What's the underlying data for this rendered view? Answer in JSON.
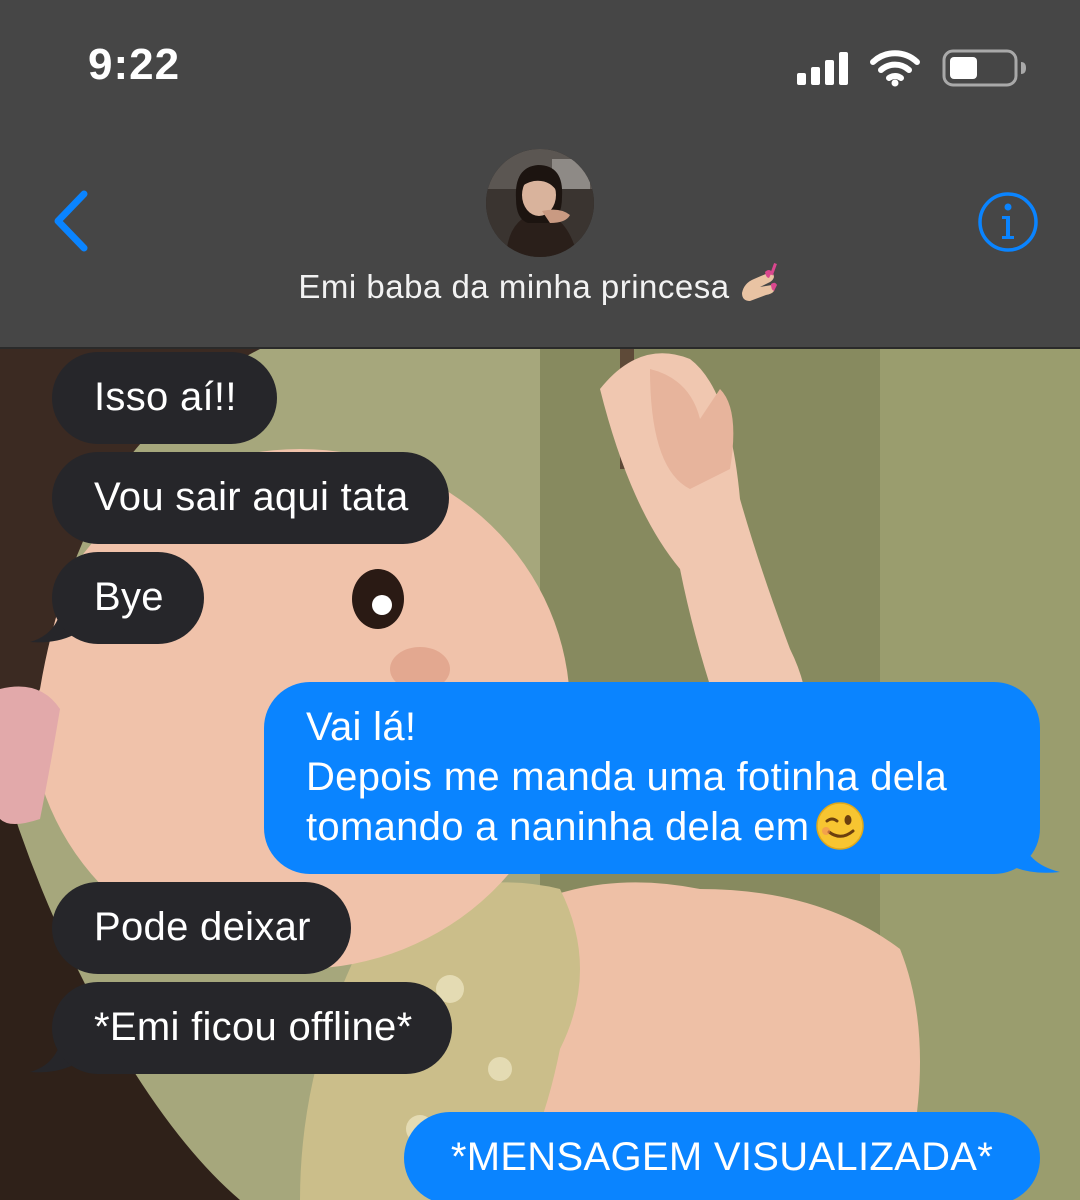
{
  "status_bar": {
    "time": "9:22",
    "icons": [
      "cellular-signal-icon",
      "wifi-icon",
      "battery-icon"
    ]
  },
  "header": {
    "back_icon": "chevron-left-icon",
    "contact_name": "Emi baba da minha princesa",
    "contact_emoji": "nail-polish-emoji",
    "info_icon": "info-circle-icon",
    "background_color": "#464646",
    "accent_color": "#0a84ff"
  },
  "messages": [
    {
      "direction": "incoming",
      "text": "Isso aí!!"
    },
    {
      "direction": "incoming",
      "text": "Vou sair aqui tata"
    },
    {
      "direction": "incoming",
      "text": "Bye"
    },
    {
      "direction": "outgoing",
      "lines": [
        "Vai lá!",
        "Depois me manda uma fotinha dela",
        "tomando a naninha dela em"
      ],
      "emoji": "winking-face-emoji"
    },
    {
      "direction": "incoming",
      "text": "Pode deixar"
    },
    {
      "direction": "incoming",
      "text": "*Emi ficou offline*"
    },
    {
      "direction": "outgoing",
      "text": "*MENSAGEM VISUALIZADA*"
    }
  ],
  "colors": {
    "incoming_bubble": "#26262a",
    "outgoing_bubble": "#0a84ff",
    "text": "#ffffff"
  }
}
